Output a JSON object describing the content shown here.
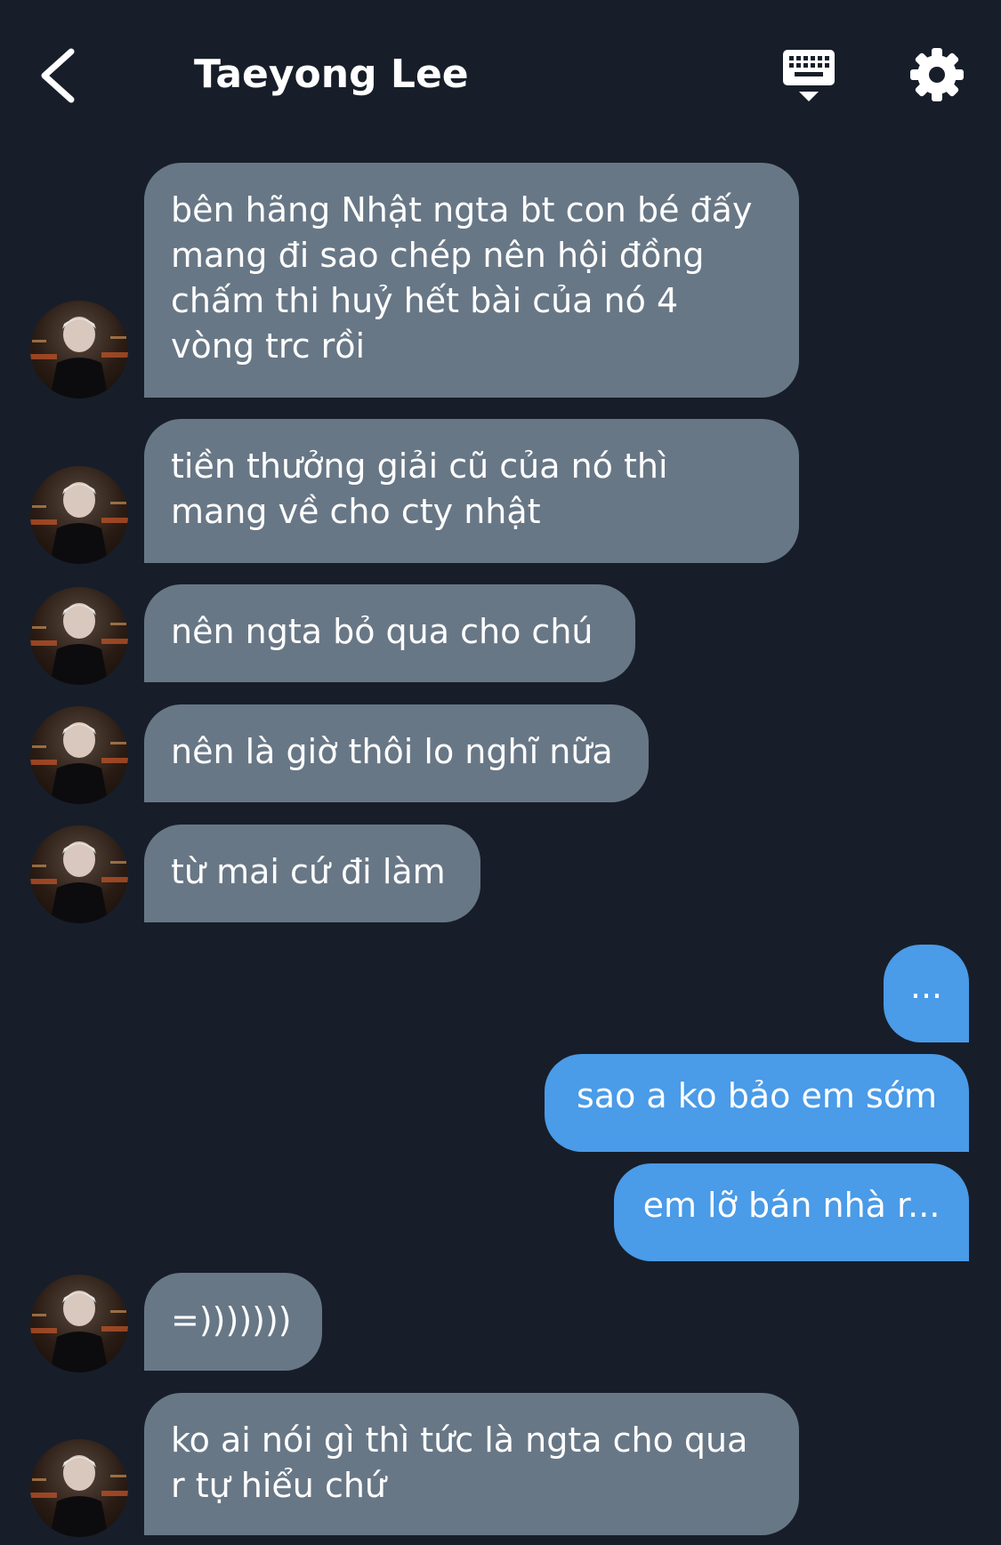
{
  "header": {
    "title": "Taeyong Lee",
    "back_icon": "chevron-left-icon",
    "keyboard_icon": "keyboard-icon",
    "settings_icon": "gear-icon"
  },
  "colors": {
    "background": "#171e29",
    "incoming_bubble": "#687786",
    "outgoing_bubble": "#4a9be8",
    "text": "#ffffff"
  },
  "messages": [
    {
      "sender": "Taeyong Lee",
      "lines": [
        "bên hãng Nhật ngta bt con bé đấy",
        "mang đi sao chép nên hội đồng",
        "chấm thi huỷ hết bài của nó 4",
        "vòng trc rồi"
      ]
    },
    {
      "sender": "Taeyong Lee",
      "lines": [
        "tiền thưởng giải cũ của nó thì",
        "mang về cho cty nhật"
      ]
    },
    {
      "sender": "Taeyong Lee",
      "lines": [
        "nên ngta bỏ qua cho chú"
      ]
    },
    {
      "sender": "Taeyong Lee",
      "lines": [
        "nên là giờ thôi lo nghĩ nữa"
      ]
    },
    {
      "sender": "Taeyong Lee",
      "lines": [
        "từ mai cứ đi làm"
      ]
    },
    {
      "sender": "me",
      "lines": [
        "..."
      ]
    },
    {
      "sender": "me",
      "lines": [
        "sao a ko bảo em sớm"
      ]
    },
    {
      "sender": "me",
      "lines": [
        "em lỡ bán nhà r..."
      ]
    },
    {
      "sender": "Taeyong Lee",
      "lines": [
        "=)))))))"
      ]
    },
    {
      "sender": "Taeyong Lee",
      "lines": [
        "ko ai nói gì thì tức là ngta cho qua",
        "r tự hiểu chứ"
      ]
    }
  ]
}
